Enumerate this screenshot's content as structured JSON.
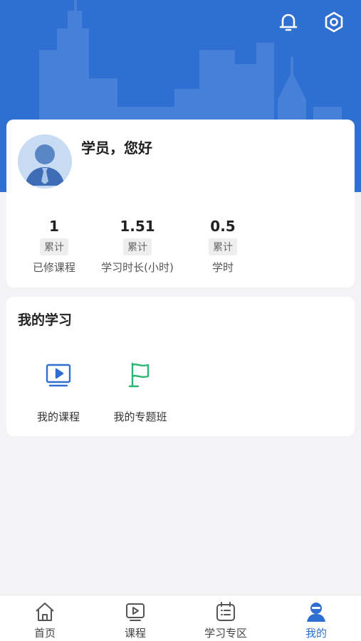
{
  "header": {
    "bell_icon": "bell-icon",
    "settings_icon": "gear-icon",
    "background_color": "#2f6fd2"
  },
  "profile": {
    "greeting": "学员，您好",
    "stats": [
      {
        "value": "1",
        "tag": "累计",
        "label": "已修课程"
      },
      {
        "value": "1.51",
        "tag": "累计",
        "label": "学习时长(小时)"
      },
      {
        "value": "0.5",
        "tag": "累计",
        "label": "学时"
      }
    ]
  },
  "study": {
    "title": "我的学习",
    "entries": [
      {
        "label": "我的课程",
        "icon": "video-course-icon",
        "color": "#2f6fd2"
      },
      {
        "label": "我的专题班",
        "icon": "flag-icon",
        "color": "#2bb673"
      }
    ]
  },
  "tabbar": {
    "active_color": "#2f6fd2",
    "tabs": [
      {
        "label": "首页",
        "icon": "home-icon"
      },
      {
        "label": "课程",
        "icon": "play-icon"
      },
      {
        "label": "学习专区",
        "icon": "list-icon"
      },
      {
        "label": "我的",
        "icon": "user-icon"
      }
    ]
  }
}
